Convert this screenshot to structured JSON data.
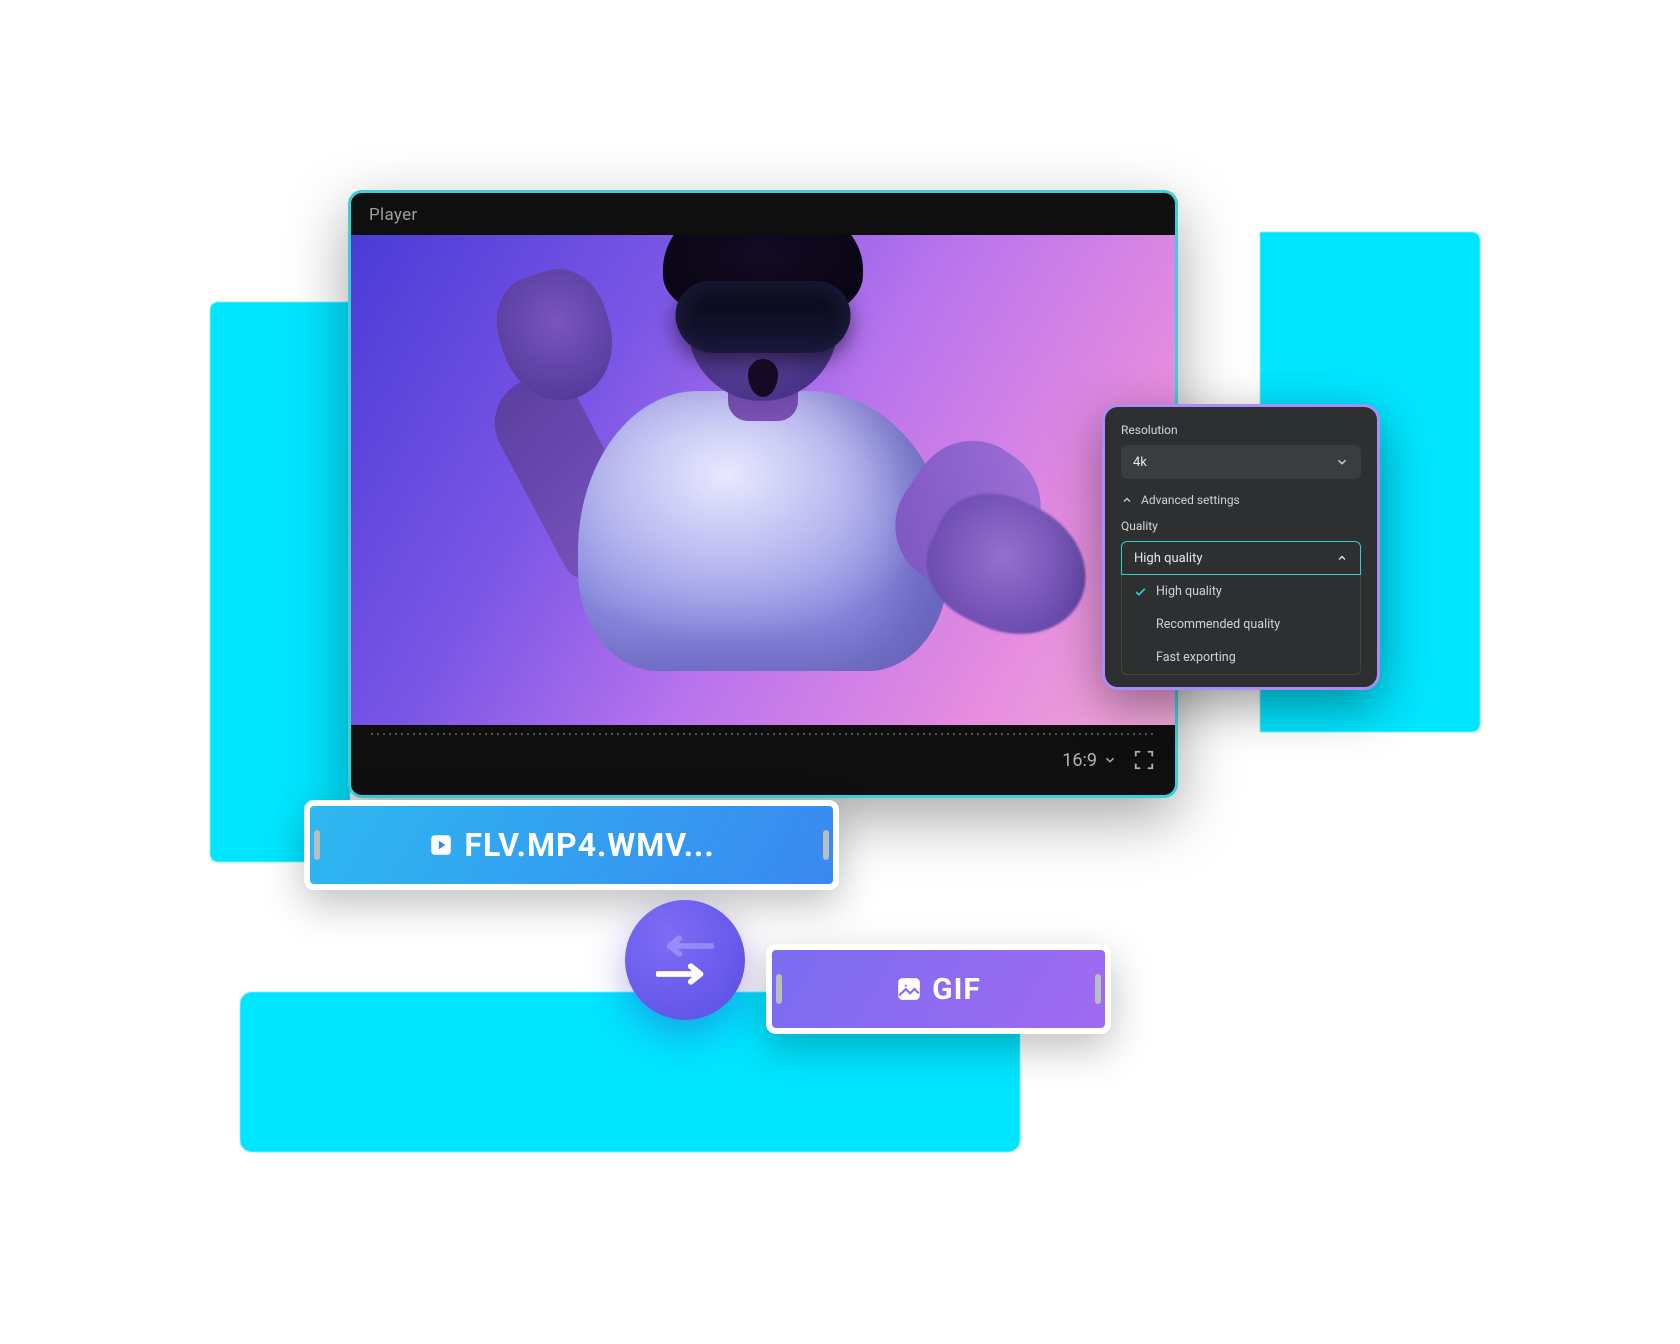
{
  "player": {
    "title": "Player",
    "aspect_ratio": "16:9"
  },
  "settings": {
    "resolution_label": "Resolution",
    "resolution_value": "4k",
    "advanced_label": "Advanced settings",
    "quality_label": "Quality",
    "quality_value": "High quality",
    "quality_options": {
      "0": "High quality",
      "1": "Recommended quality",
      "2": "Fast exporting"
    }
  },
  "chips": {
    "video_formats": "FLV.MP4.WMV...",
    "gif": "GIF"
  }
}
